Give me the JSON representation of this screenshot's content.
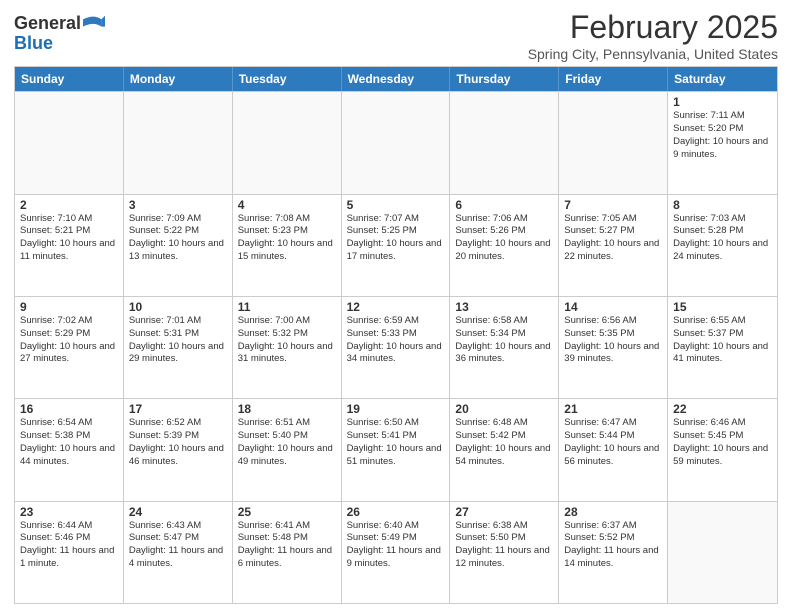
{
  "header": {
    "logo": {
      "line1": "General",
      "line2": "Blue"
    },
    "title": "February 2025",
    "location": "Spring City, Pennsylvania, United States"
  },
  "days_of_week": [
    "Sunday",
    "Monday",
    "Tuesday",
    "Wednesday",
    "Thursday",
    "Friday",
    "Saturday"
  ],
  "weeks": [
    [
      {
        "day": "",
        "empty": true
      },
      {
        "day": "",
        "empty": true
      },
      {
        "day": "",
        "empty": true
      },
      {
        "day": "",
        "empty": true
      },
      {
        "day": "",
        "empty": true
      },
      {
        "day": "",
        "empty": true
      },
      {
        "day": "1",
        "sunrise": "7:11 AM",
        "sunset": "5:20 PM",
        "daylight": "10 hours and 9 minutes."
      }
    ],
    [
      {
        "day": "2",
        "sunrise": "7:10 AM",
        "sunset": "5:21 PM",
        "daylight": "10 hours and 11 minutes."
      },
      {
        "day": "3",
        "sunrise": "7:09 AM",
        "sunset": "5:22 PM",
        "daylight": "10 hours and 13 minutes."
      },
      {
        "day": "4",
        "sunrise": "7:08 AM",
        "sunset": "5:23 PM",
        "daylight": "10 hours and 15 minutes."
      },
      {
        "day": "5",
        "sunrise": "7:07 AM",
        "sunset": "5:25 PM",
        "daylight": "10 hours and 17 minutes."
      },
      {
        "day": "6",
        "sunrise": "7:06 AM",
        "sunset": "5:26 PM",
        "daylight": "10 hours and 20 minutes."
      },
      {
        "day": "7",
        "sunrise": "7:05 AM",
        "sunset": "5:27 PM",
        "daylight": "10 hours and 22 minutes."
      },
      {
        "day": "8",
        "sunrise": "7:03 AM",
        "sunset": "5:28 PM",
        "daylight": "10 hours and 24 minutes."
      }
    ],
    [
      {
        "day": "9",
        "sunrise": "7:02 AM",
        "sunset": "5:29 PM",
        "daylight": "10 hours and 27 minutes."
      },
      {
        "day": "10",
        "sunrise": "7:01 AM",
        "sunset": "5:31 PM",
        "daylight": "10 hours and 29 minutes."
      },
      {
        "day": "11",
        "sunrise": "7:00 AM",
        "sunset": "5:32 PM",
        "daylight": "10 hours and 31 minutes."
      },
      {
        "day": "12",
        "sunrise": "6:59 AM",
        "sunset": "5:33 PM",
        "daylight": "10 hours and 34 minutes."
      },
      {
        "day": "13",
        "sunrise": "6:58 AM",
        "sunset": "5:34 PM",
        "daylight": "10 hours and 36 minutes."
      },
      {
        "day": "14",
        "sunrise": "6:56 AM",
        "sunset": "5:35 PM",
        "daylight": "10 hours and 39 minutes."
      },
      {
        "day": "15",
        "sunrise": "6:55 AM",
        "sunset": "5:37 PM",
        "daylight": "10 hours and 41 minutes."
      }
    ],
    [
      {
        "day": "16",
        "sunrise": "6:54 AM",
        "sunset": "5:38 PM",
        "daylight": "10 hours and 44 minutes."
      },
      {
        "day": "17",
        "sunrise": "6:52 AM",
        "sunset": "5:39 PM",
        "daylight": "10 hours and 46 minutes."
      },
      {
        "day": "18",
        "sunrise": "6:51 AM",
        "sunset": "5:40 PM",
        "daylight": "10 hours and 49 minutes."
      },
      {
        "day": "19",
        "sunrise": "6:50 AM",
        "sunset": "5:41 PM",
        "daylight": "10 hours and 51 minutes."
      },
      {
        "day": "20",
        "sunrise": "6:48 AM",
        "sunset": "5:42 PM",
        "daylight": "10 hours and 54 minutes."
      },
      {
        "day": "21",
        "sunrise": "6:47 AM",
        "sunset": "5:44 PM",
        "daylight": "10 hours and 56 minutes."
      },
      {
        "day": "22",
        "sunrise": "6:46 AM",
        "sunset": "5:45 PM",
        "daylight": "10 hours and 59 minutes."
      }
    ],
    [
      {
        "day": "23",
        "sunrise": "6:44 AM",
        "sunset": "5:46 PM",
        "daylight": "11 hours and 1 minute."
      },
      {
        "day": "24",
        "sunrise": "6:43 AM",
        "sunset": "5:47 PM",
        "daylight": "11 hours and 4 minutes."
      },
      {
        "day": "25",
        "sunrise": "6:41 AM",
        "sunset": "5:48 PM",
        "daylight": "11 hours and 6 minutes."
      },
      {
        "day": "26",
        "sunrise": "6:40 AM",
        "sunset": "5:49 PM",
        "daylight": "11 hours and 9 minutes."
      },
      {
        "day": "27",
        "sunrise": "6:38 AM",
        "sunset": "5:50 PM",
        "daylight": "11 hours and 12 minutes."
      },
      {
        "day": "28",
        "sunrise": "6:37 AM",
        "sunset": "5:52 PM",
        "daylight": "11 hours and 14 minutes."
      },
      {
        "day": "",
        "empty": true
      }
    ]
  ],
  "labels": {
    "sunrise": "Sunrise:",
    "sunset": "Sunset:",
    "daylight": "Daylight:"
  }
}
